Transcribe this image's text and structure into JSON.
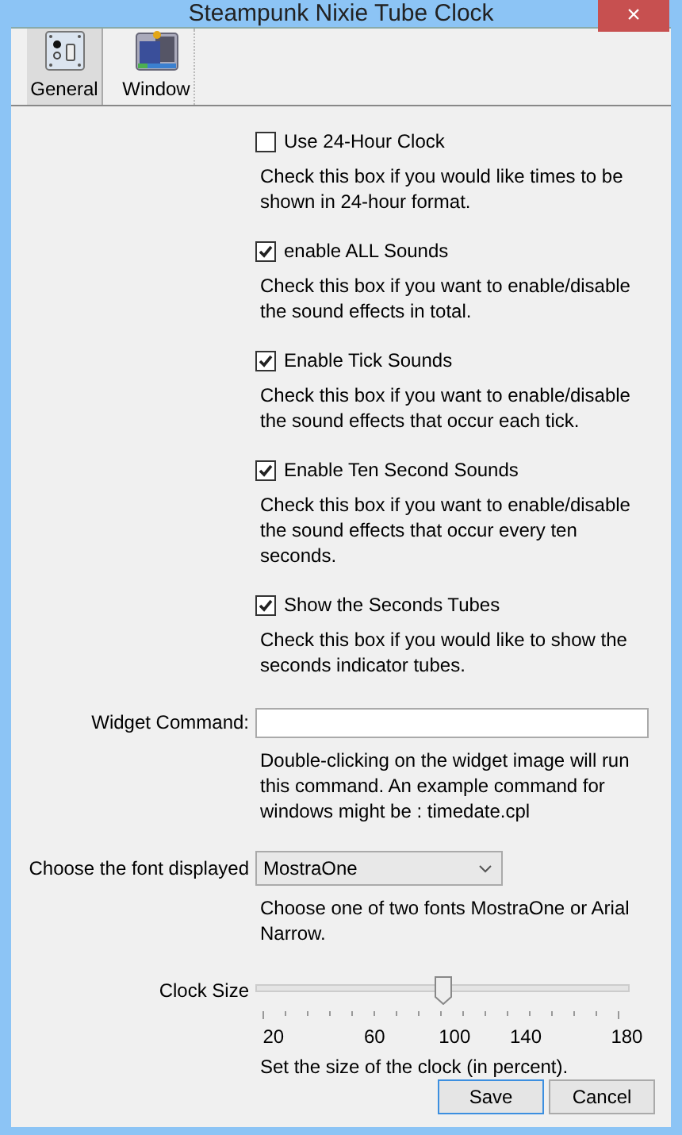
{
  "window": {
    "title": "Steampunk Nixie Tube Clock",
    "close": "×"
  },
  "toolbar": [
    {
      "label": "General",
      "kind": "general",
      "selected": true
    },
    {
      "label": "Window",
      "kind": "window",
      "selected": false
    }
  ],
  "options": [
    {
      "label": "Use 24-Hour Clock",
      "checked": false,
      "description": "Check this box if you would like times to be shown in 24-hour format."
    },
    {
      "label": "enable ALL Sounds",
      "checked": true,
      "description": "Check this box if you want to enable/disable the sound effects in total."
    },
    {
      "label": "Enable Tick Sounds",
      "checked": true,
      "description": "Check this box if you want to enable/disable the sound effects that occur each tick."
    },
    {
      "label": "Enable Ten Second Sounds",
      "checked": true,
      "description": "Check this box if you want to enable/disable the sound effects that occur every ten seconds."
    },
    {
      "label": "Show the Seconds Tubes",
      "checked": true,
      "description": "Check this box if you would like to show the seconds indicator tubes."
    }
  ],
  "widget_command": {
    "label": "Widget Command:",
    "description": "Double-clicking on the widget image will run this command. An example command for windows might be : timedate.cpl"
  },
  "font": {
    "label": "Choose the font displayed",
    "value": "MostraOne",
    "description": "Choose one of two fonts MostraOne or Arial Narrow."
  },
  "clock_size": {
    "label": "Clock Size",
    "level": 0.5,
    "ticks": [
      "20",
      "60",
      "100",
      "140",
      "180"
    ],
    "description": "Set the size of the clock (in percent)."
  },
  "buttons": [
    "Save",
    "Cancel"
  ]
}
